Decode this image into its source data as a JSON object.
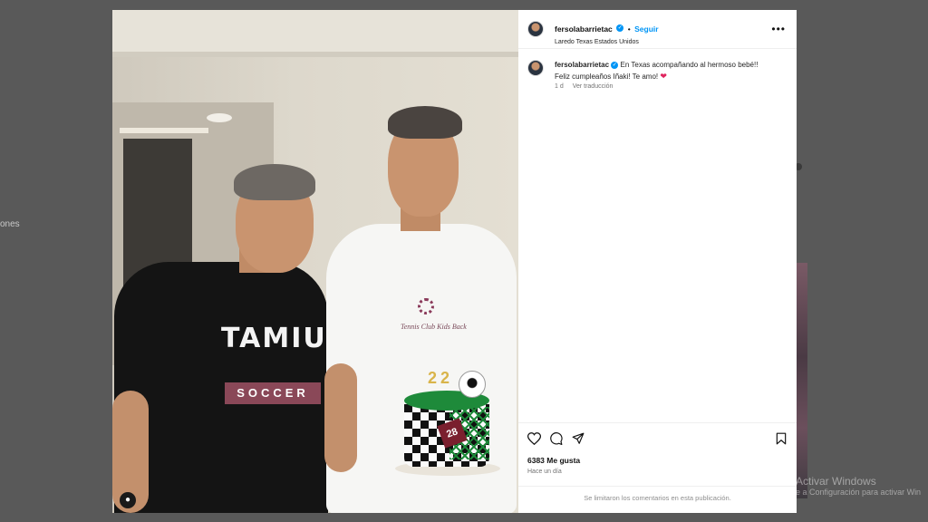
{
  "background": {
    "left_text": "ones",
    "activate_title": "Activar Windows",
    "activate_sub": "e a Configuración para activar Win"
  },
  "post": {
    "photo": {
      "shirt_text": "TAMIU",
      "shirt_band": "SOCCER",
      "tee_logo_text": "Tennis Club Kids Back",
      "candle_digits": [
        "2",
        "2"
      ],
      "jersey_number": "28"
    },
    "header": {
      "username": "fersolabarrietac",
      "separator": "•",
      "follow_label": "Seguir",
      "location": "Laredo Texas Estados Unidos",
      "more_label": "•••"
    },
    "caption": {
      "username": "fersolabarrietac",
      "line1": "En Texas acompañando al hermoso bebé!!",
      "line2": "Feliz cumpleaños Iñaki! Te amo!",
      "heart": "❤",
      "age": "1 d",
      "translate_label": "Ver traducción"
    },
    "actions": {
      "like_icon": "heart-outline-icon",
      "comment_icon": "comment-icon",
      "share_icon": "send-icon",
      "save_icon": "bookmark-icon",
      "likes_count": "6383",
      "likes_label": "Me gusta",
      "timestamp": "Hace un día"
    },
    "footer_text": "Se limitaron los comentarios en esta publicación."
  },
  "colors": {
    "accent": "#0095f6",
    "heart": "#e0245e"
  }
}
